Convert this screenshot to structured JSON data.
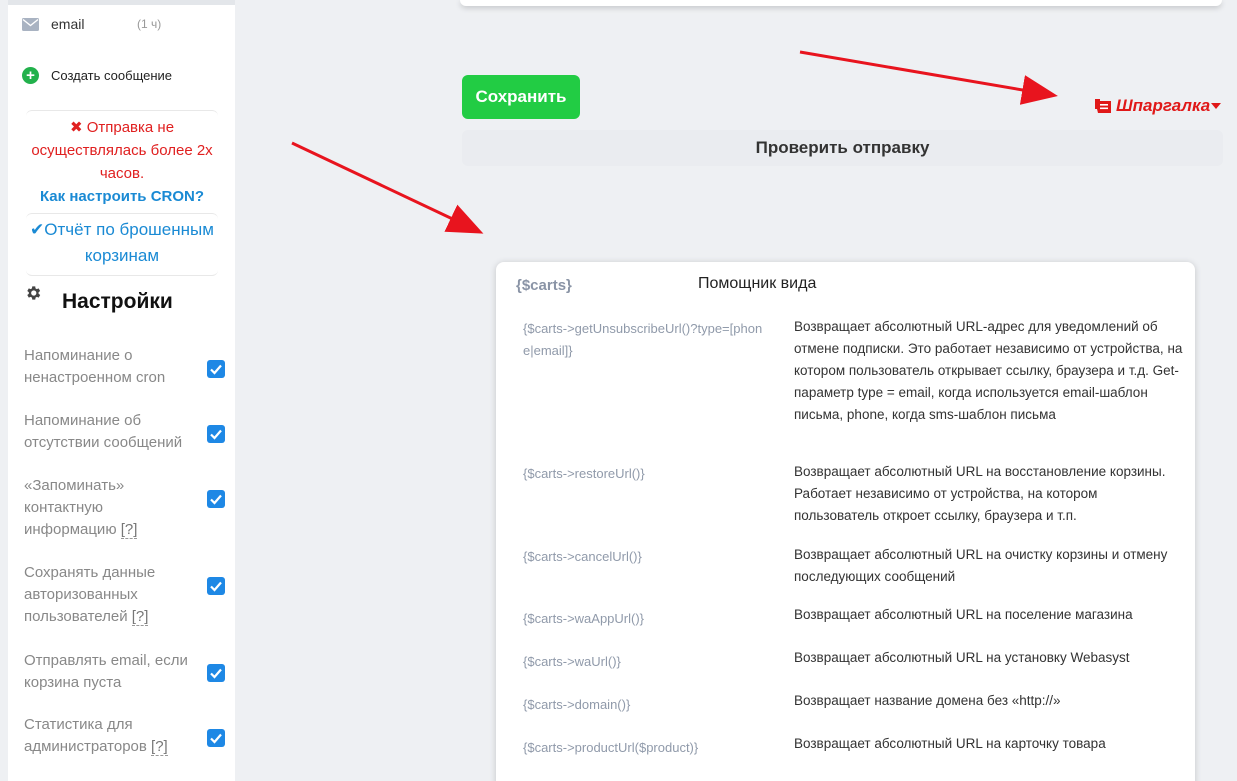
{
  "sidebar": {
    "email": {
      "label": "email",
      "count": "(1 ч)"
    },
    "create_message": "Создать сообщение",
    "cron": {
      "warning_icon": "✖",
      "warning": "Отправка не осуществлялась более 2х часов.",
      "link": "Как настроить CRON?"
    },
    "report": {
      "icon": "✔",
      "label": "Отчёт по брошенным корзинам"
    },
    "settings_title": "Настройки",
    "settings": [
      {
        "label": "Напоминание о ненастроенном cron",
        "hint": "",
        "checked": true
      },
      {
        "label": "Напоминание об отсутствии сообщений",
        "hint": "",
        "checked": true
      },
      {
        "label": "«Запоминать» контактную информацию",
        "hint": "[?]",
        "checked": true
      },
      {
        "label": "Сохранять данные авторизованных пользователей",
        "hint": "[?]",
        "checked": true
      },
      {
        "label": "Отправлять email, если корзина пуста",
        "hint": "",
        "checked": true
      },
      {
        "label": "Статистика для администраторов",
        "hint": "[?]",
        "checked": true
      }
    ]
  },
  "main": {
    "save_button": "Сохранить",
    "cheat_sheet": "Шпаргалка",
    "check_button": "Проверить отправку",
    "helper": {
      "var_title": "{$carts}",
      "title": "Помощник вида",
      "rows": [
        {
          "code": "{$carts->getUnsubscribeUrl()?type=[phone|email]}",
          "desc": "Возвращает абсолютный URL-адрес для уведомлений об отмене подписки. Это работает независимо от устройства, на котором пользователь открывает ссылку, браузера и т.д. Get-параметр type = email, когда используется email-шаблон письма, phone, когда sms-шаблон письма"
        },
        {
          "code": "{$carts->restoreUrl()}",
          "desc": "Возвращает абсолютный URL на восстановление корзины. Работает независимо от устройства, на котором пользователь откроет ссылку, браузера и т.п."
        },
        {
          "code": "{$carts->cancelUrl()}",
          "desc": "Возвращает абсолютный URL на очистку корзины и отмену последующих сообщений"
        },
        {
          "code": "{$carts->waAppUrl()}",
          "desc": "Возвращает абсолютный URL на поселение магазина"
        },
        {
          "code": "{$carts->waUrl()}",
          "desc": "Возвращает абсолютный URL на установку Webasyst"
        },
        {
          "code": "{$carts->domain()}",
          "desc": "Возвращает название домена без «http://»"
        },
        {
          "code": "{$carts->productUrl($product)}",
          "desc": "Возвращает абсолютный URL на карточку товара"
        }
      ]
    }
  },
  "colors": {
    "save": "#22cc44",
    "accent_red": "#e01818",
    "link_blue": "#1a8ad4",
    "checkbox": "#1e88e5"
  },
  "icons": [
    "envelope-icon",
    "plus-circle-icon",
    "close-icon",
    "check-icon",
    "gear-icon",
    "cheat-sheet-icon",
    "caret-down-icon",
    "checkbox-checked-icon"
  ]
}
